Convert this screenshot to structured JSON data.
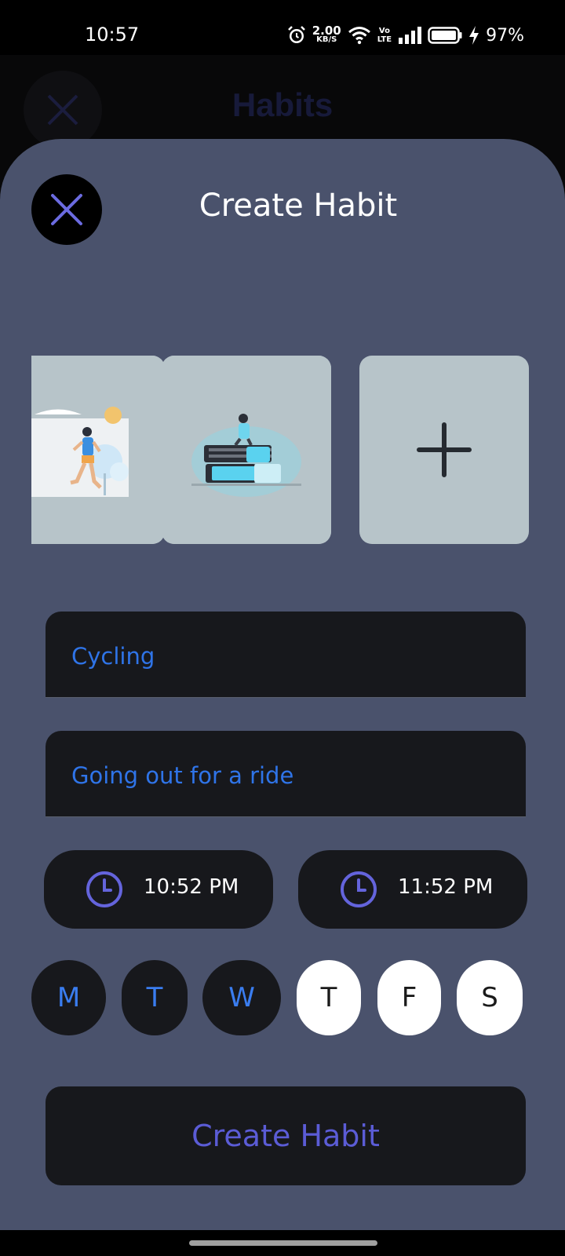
{
  "status_bar": {
    "time": "10:57",
    "net_speed": "2.00",
    "net_unit": "KB/S",
    "volte_top": "Vo",
    "volte_bottom": "LTE",
    "battery": "97%",
    "icons": [
      "alarm-icon",
      "wifi-icon",
      "signal-icon",
      "battery-icon",
      "charging-icon"
    ]
  },
  "background_page": {
    "title": "Habits"
  },
  "sheet": {
    "title": "Create Habit",
    "close_icon": "close-icon",
    "images": [
      {
        "name": "running-illustration"
      },
      {
        "name": "reading-books-illustration"
      },
      {
        "name": "add-image-icon"
      }
    ],
    "name_field": {
      "value": "Cycling"
    },
    "description_field": {
      "value": "Going out for a ride"
    },
    "start_time": "10:52 PM",
    "end_time": "11:52 PM",
    "days": [
      {
        "label": "M",
        "selected": true
      },
      {
        "label": "T",
        "selected": true
      },
      {
        "label": "W",
        "selected": true
      },
      {
        "label": "T",
        "selected": false
      },
      {
        "label": "F",
        "selected": false
      },
      {
        "label": "S",
        "selected": false
      }
    ],
    "create_button": "Create Habit"
  },
  "colors": {
    "sheet_bg": "#4a526c",
    "dark": "#17181c",
    "accent_blue": "#2f74e8",
    "accent_purple": "#5b5cd6",
    "card_bg": "#b7c4c9"
  }
}
